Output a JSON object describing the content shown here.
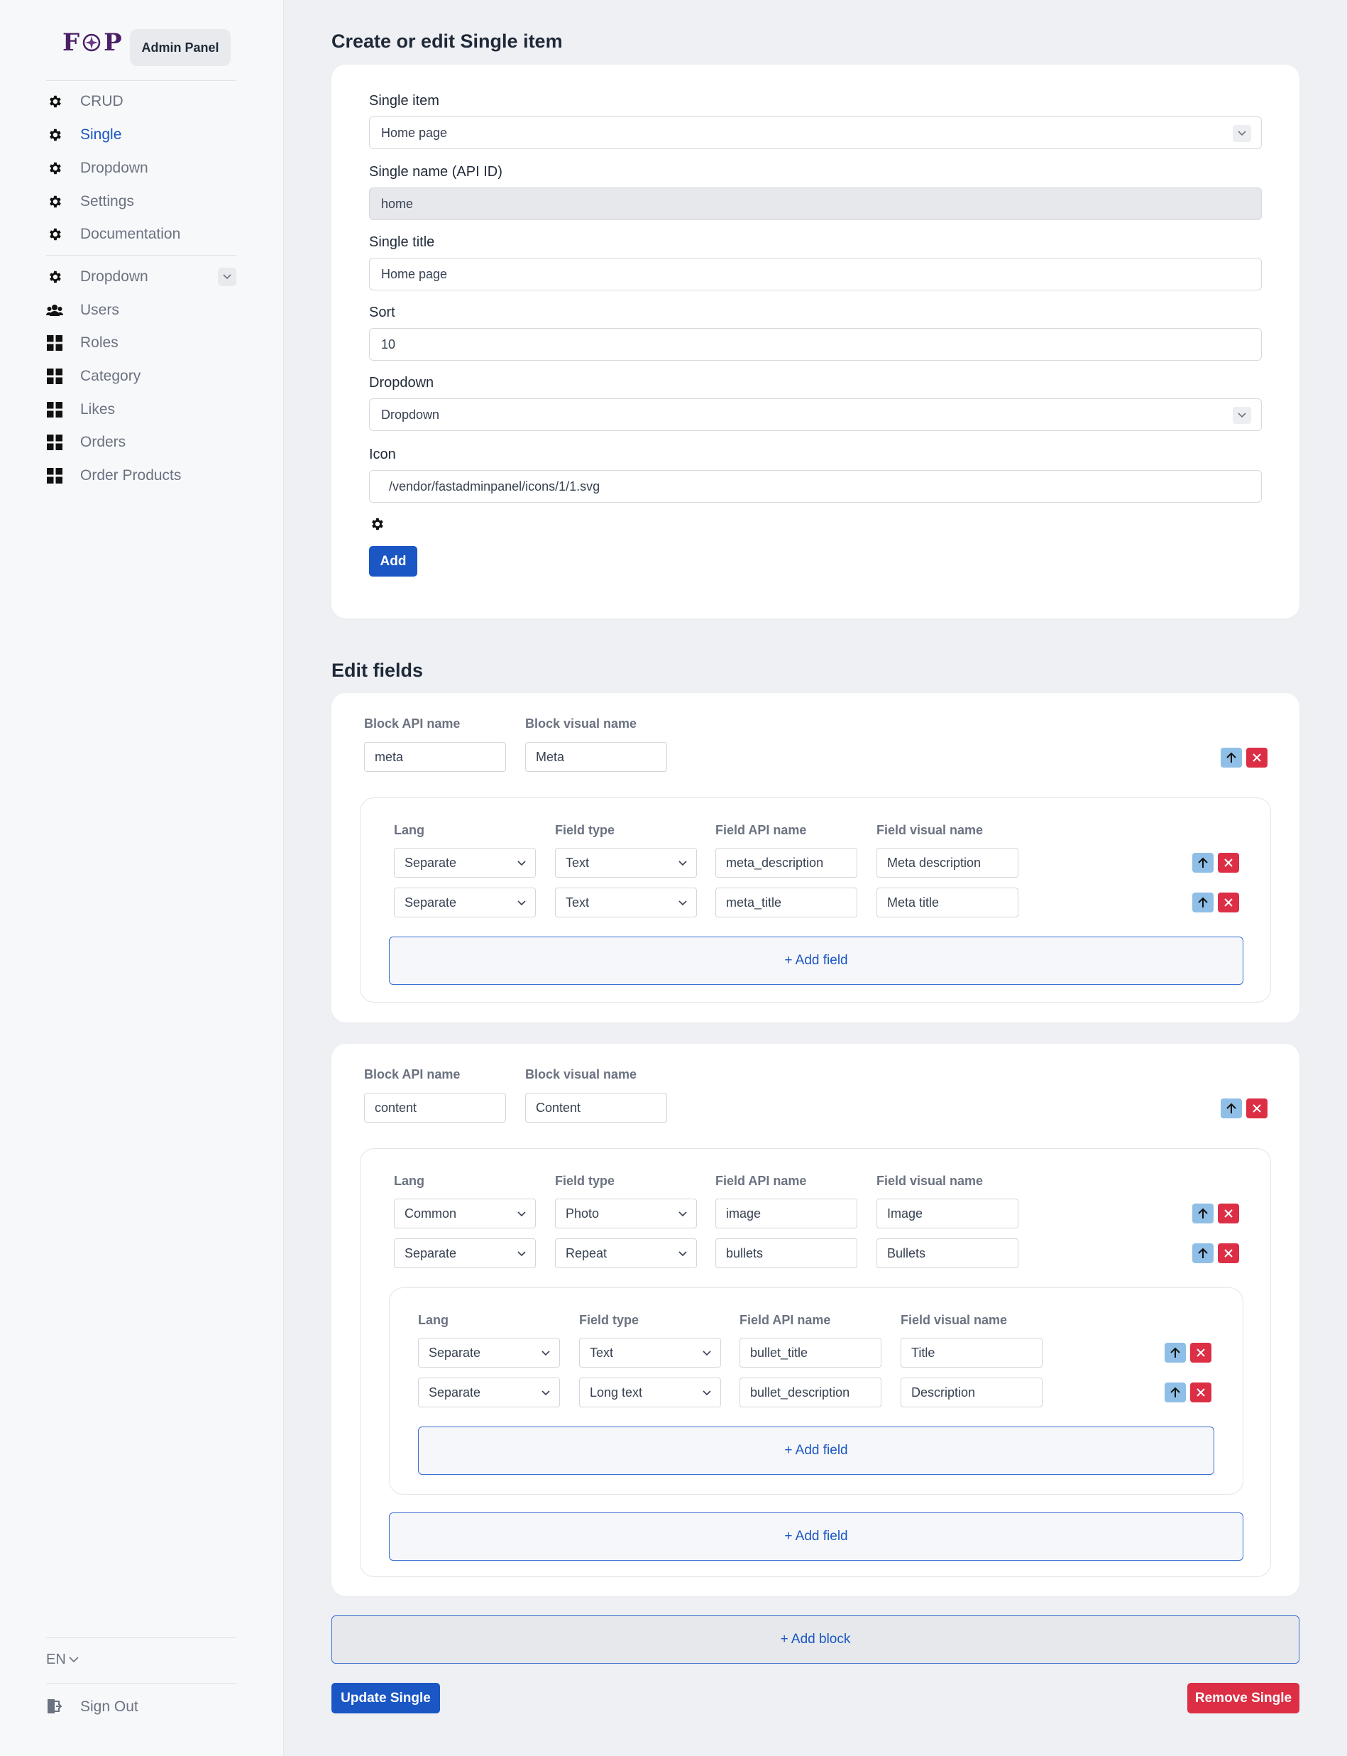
{
  "brand": {
    "letter1": "F",
    "letter2": "P",
    "badge": "Admin Panel"
  },
  "sidebar": {
    "top_items": [
      {
        "label": "CRUD",
        "icon": "gear-icon"
      },
      {
        "label": "Single",
        "icon": "gear-icon",
        "active": true
      },
      {
        "label": "Dropdown",
        "icon": "gear-icon"
      },
      {
        "label": "Settings",
        "icon": "gear-icon"
      },
      {
        "label": "Documentation",
        "icon": "gear-icon"
      }
    ],
    "bottom_items": [
      {
        "label": "Dropdown",
        "icon": "gear-icon"
      },
      {
        "label": "Users",
        "icon": "users-icon"
      },
      {
        "label": "Roles",
        "icon": "grid-icon"
      },
      {
        "label": "Category",
        "icon": "grid-icon"
      },
      {
        "label": "Likes",
        "icon": "grid-icon"
      },
      {
        "label": "Orders",
        "icon": "grid-icon"
      },
      {
        "label": "Order Products",
        "icon": "grid-icon"
      }
    ],
    "language": "EN",
    "sign_out": "Sign Out"
  },
  "form": {
    "title": "Create or edit Single item",
    "single_item_label": "Single item",
    "single_item_value": "Home page",
    "api_id_label": "Single name (API ID)",
    "api_id_value": "home",
    "title_label": "Single title",
    "title_value": "Home page",
    "sort_label": "Sort",
    "sort_value": "10",
    "dropdown_label": "Dropdown",
    "dropdown_value": "Dropdown",
    "icon_label": "Icon",
    "icon_value": "/vendor/fastadminpanel/icons/1/1.svg",
    "add_button": "Add"
  },
  "edit_fields": {
    "title": "Edit fields",
    "block_api_label": "Block API name",
    "block_visual_label": "Block visual name",
    "col_lang": "Lang",
    "col_type": "Field type",
    "col_api": "Field API name",
    "col_visual": "Field visual name",
    "add_field": "+ Add field",
    "add_block": "+ Add block",
    "blocks": [
      {
        "api_name": "meta",
        "visual_name": "Meta",
        "fields": [
          {
            "lang": "Separate",
            "type": "Text",
            "api": "meta_description",
            "visual": "Meta description"
          },
          {
            "lang": "Separate",
            "type": "Text",
            "api": "meta_title",
            "visual": "Meta title"
          }
        ]
      },
      {
        "api_name": "content",
        "visual_name": "Content",
        "fields": [
          {
            "lang": "Common",
            "type": "Photo",
            "api": "image",
            "visual": "Image"
          },
          {
            "lang": "Separate",
            "type": "Repeat",
            "api": "bullets",
            "visual": "Bullets"
          }
        ],
        "nested_fields": [
          {
            "lang": "Separate",
            "type": "Text",
            "api": "bullet_title",
            "visual": "Title"
          },
          {
            "lang": "Separate",
            "type": "Long text",
            "api": "bullet_description",
            "visual": "Description"
          }
        ]
      }
    ]
  },
  "actions": {
    "update": "Update Single",
    "remove": "Remove Single"
  },
  "colors": {
    "primary": "#1a56c4",
    "danger": "#dc2f45",
    "brand": "#4b1f66",
    "up_button": "#8fbfe6"
  }
}
